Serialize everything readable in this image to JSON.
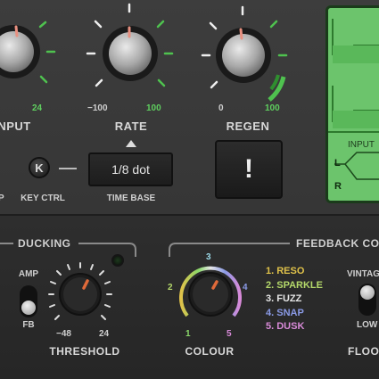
{
  "top": {
    "input": {
      "label": "INPUT",
      "max_label": "24"
    },
    "rate": {
      "label": "RATE",
      "min_label": "−100",
      "max_label": "100"
    },
    "regen": {
      "label": "REGEN",
      "min_label": "0",
      "max_label": "100"
    },
    "key_ctrl": {
      "button_label": "K",
      "label": "KEY CTRL",
      "left_partial_label": "P"
    },
    "time_base": {
      "value": "1/8 dot",
      "label": "TIME BASE"
    },
    "trigger_button": {
      "symbol": "!"
    },
    "screen": {
      "input_label": "INPUT",
      "left_label": "L",
      "right_label": "R"
    }
  },
  "ducking": {
    "title": "DUCKING",
    "toggle": {
      "top_label": "AMP",
      "bottom_label": "FB"
    },
    "threshold": {
      "label": "THRESHOLD",
      "min_label": "−48",
      "max_label": "24"
    }
  },
  "feedback": {
    "title": "FEEDBACK CO",
    "colour": {
      "label": "COLOUR",
      "scale": [
        "1",
        "2",
        "3",
        "4",
        "5"
      ]
    },
    "modes": [
      {
        "label": "1. RESO",
        "color": "#e0c24a"
      },
      {
        "label": "2. SPARKLE",
        "color": "#b4d86a"
      },
      {
        "label": "3. FUZZ",
        "color": "#e6e6e6"
      },
      {
        "label": "4. SNAP",
        "color": "#8a9ae6"
      },
      {
        "label": "5. DUSK",
        "color": "#d88ad8"
      }
    ],
    "floor": {
      "top_label": "VINTAG",
      "bottom_label": "LOW",
      "label": "FLOO"
    }
  },
  "colors": {
    "accent_green": "#5fcf5f",
    "knob_pointer": "#e06a3a"
  }
}
